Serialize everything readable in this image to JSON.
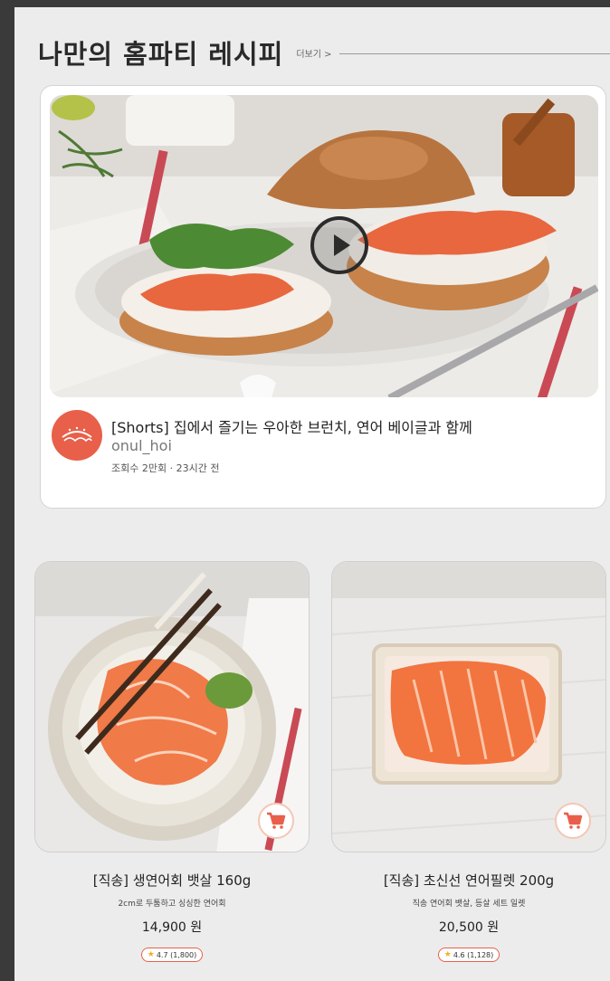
{
  "section": {
    "title": "나만의 홈파티 레시피",
    "more_label": "더보기 >"
  },
  "video": {
    "title": "[Shorts] 집에서 즐기는 우아한 브런치, 연어 베이글과 함께",
    "channel": "onul_hoi",
    "meta": "조회수 2만회 · 23시간 전"
  },
  "products": [
    {
      "name": "[직송] 생연어회 뱃살 160g",
      "desc": "2cm로 두툼하고 싱싱한 연어회",
      "price": "14,900 원",
      "rating": "4.7 (1,800)"
    },
    {
      "name": "[직송] 초신선 연어필렛 200g",
      "desc": "직송 연어회 뱃살, 등살 세트 일렛",
      "price": "20,500 원",
      "rating": "4.6 (1,128)"
    }
  ],
  "colors": {
    "accent": "#e8604a",
    "star": "#f2b01e",
    "panel_bg": "#ececec",
    "outer_bg": "#3a3a3a"
  },
  "icons": {
    "play": "play-icon",
    "cart": "cart-icon",
    "star": "star-icon",
    "avatar": "channel-logo-icon"
  }
}
